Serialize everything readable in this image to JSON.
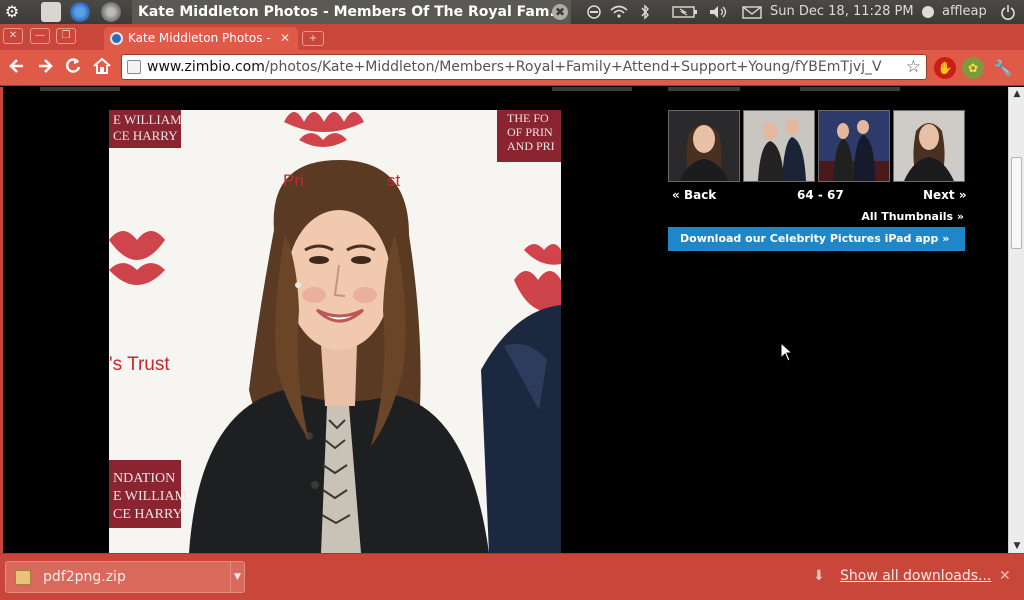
{
  "panel": {
    "window_title": "Kate Middleton Photos - Members Of The Royal Fam...",
    "close_glyph": "✖",
    "datetime": "Sun Dec 18, 11:28 PM",
    "user": "affleap"
  },
  "browser": {
    "tab_title": "Kate Middleton Photos - ",
    "tab_close": "✕",
    "url_host": "www.zimbio.com",
    "url_path": "/photos/Kate+Middleton/Members+Royal+Family+Attend+Support+Young/fYBEmTjvj_V"
  },
  "photo": {
    "banner_left_top": "E WILLIAM",
    "banner_left_top2": "CE HARRY",
    "banner_right_top": "THE FO",
    "banner_right_mid": "OF PRIN",
    "banner_right_bot": "AND PRI",
    "logo_text": "Pri",
    "logo_text2": "st",
    "trust_text": "'s Trust",
    "banner_left_bot": "NDATION",
    "banner_left_bot2": "E WILLIAM",
    "banner_left_bot3": "CE HARRY"
  },
  "gallery": {
    "back_label": "Back",
    "range_label": "64 - 67",
    "next_label": "Next",
    "all_thumbnails": "All Thumbnails »",
    "ipad_app": "Download our Celebrity Pictures iPad app »"
  },
  "downloads": {
    "file_name": "pdf2png.zip",
    "show_all": "Show all downloads..."
  },
  "colors": {
    "chrome_frame": "#c8463a",
    "ipad_button": "#1f87c7"
  }
}
